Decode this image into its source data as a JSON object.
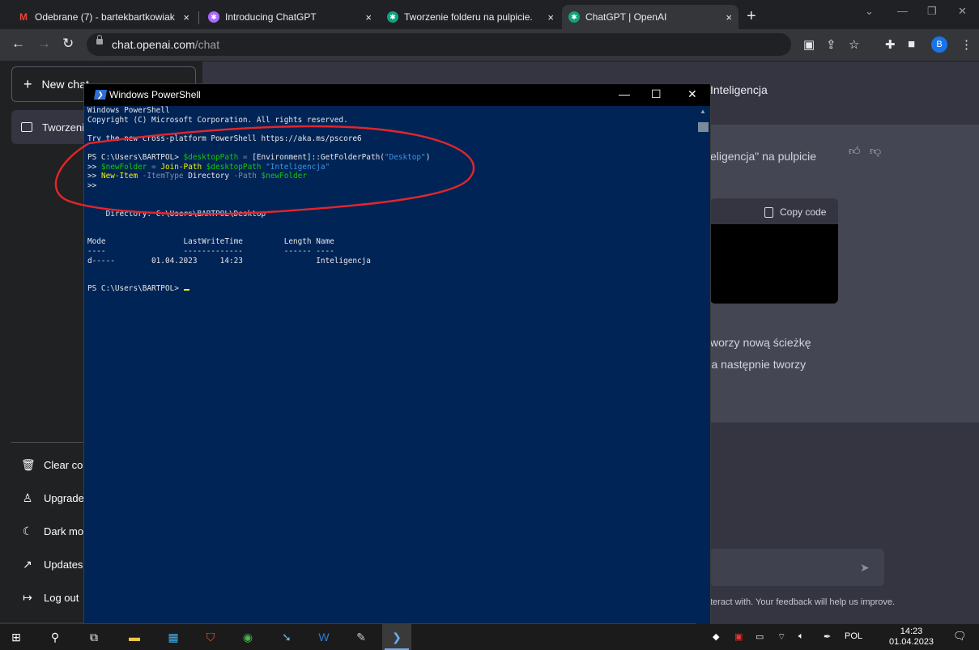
{
  "browser": {
    "tabs": [
      {
        "title": "Odebrane (7) - bartekbartkowiak",
        "favicon": "gmail-icon",
        "color": "#ea4335"
      },
      {
        "title": "Introducing ChatGPT",
        "favicon": "openai-icon",
        "color": "#ab68ff"
      },
      {
        "title": "Tworzenie folderu na pulpicie.",
        "favicon": "chatgpt-icon",
        "color": "#10a37f"
      },
      {
        "title": "ChatGPT | OpenAI",
        "favicon": "chatgpt-icon",
        "color": "#10a37f"
      }
    ],
    "close_glyph": "×",
    "new_tab_glyph": "+",
    "url_host": "chat.openai.com",
    "url_path": "/chat",
    "profile_initial": "B"
  },
  "sidebar": {
    "new_chat": "New chat",
    "chat_item": "Tworzenie",
    "bottom_items": [
      {
        "label": "Clear conv",
        "icon": "trash-icon",
        "glyph": "🗑"
      },
      {
        "label": "Upgrade t",
        "icon": "user-icon",
        "glyph": "♙"
      },
      {
        "label": "Dark mod",
        "icon": "moon-icon",
        "glyph": "☾"
      },
      {
        "label": "Updates &",
        "icon": "external-link-icon",
        "glyph": "↗"
      },
      {
        "label": "Log out",
        "icon": "logout-icon",
        "glyph": "↦"
      }
    ]
  },
  "chat": {
    "title": "Inteligencja",
    "response_line_1": "eligencja\" na pulpicie",
    "copy_code": "Copy code",
    "response_line_2": "worzy nową ścieżkę",
    "response_line_3": "', a następnie tworzy",
    "footer": "teract with. Your feedback will help us improve."
  },
  "powershell": {
    "window_title": "Windows PowerShell",
    "lines": [
      [
        {
          "t": "Windows PowerShell",
          "c": "w"
        }
      ],
      [
        {
          "t": "Copyright (C) Microsoft Corporation. All rights reserved.",
          "c": "w"
        }
      ],
      [
        {
          "t": "",
          "c": "w"
        }
      ],
      [
        {
          "t": "Try the new cross-platform PowerShell https://aka.ms/pscore6",
          "c": "w"
        }
      ],
      [
        {
          "t": "",
          "c": "w"
        }
      ],
      [
        {
          "t": "PS C:\\Users\\BARTPOL> ",
          "c": "w"
        },
        {
          "t": "$desktopPath",
          "c": "g"
        },
        {
          "t": " = ",
          "c": "gr"
        },
        {
          "t": "[Environment]",
          "c": "w"
        },
        {
          "t": "::GetFolderPath(",
          "c": "w"
        },
        {
          "t": "\"Desktop\"",
          "c": "cy"
        },
        {
          "t": ")",
          "c": "w"
        }
      ],
      [
        {
          "t": ">> ",
          "c": "w"
        },
        {
          "t": "$newFolder",
          "c": "g"
        },
        {
          "t": " = ",
          "c": "gr"
        },
        {
          "t": "Join-Path ",
          "c": "y"
        },
        {
          "t": "$desktopPath ",
          "c": "g"
        },
        {
          "t": "\"Inteligencja\"",
          "c": "cy"
        }
      ],
      [
        {
          "t": ">> ",
          "c": "w"
        },
        {
          "t": "New-Item ",
          "c": "y"
        },
        {
          "t": "-ItemType ",
          "c": "gr"
        },
        {
          "t": "Directory ",
          "c": "w"
        },
        {
          "t": "-Path ",
          "c": "gr"
        },
        {
          "t": "$newFolder",
          "c": "g"
        }
      ],
      [
        {
          "t": ">>",
          "c": "w"
        }
      ],
      [
        {
          "t": "",
          "c": "w"
        }
      ],
      [
        {
          "t": "",
          "c": "w"
        }
      ],
      [
        {
          "t": "    Directory: C:\\Users\\BARTPOL\\Desktop",
          "c": "w"
        }
      ],
      [
        {
          "t": "",
          "c": "w"
        }
      ],
      [
        {
          "t": "",
          "c": "w"
        }
      ],
      [
        {
          "t": "Mode                 LastWriteTime         Length Name",
          "c": "w"
        }
      ],
      [
        {
          "t": "----                 -------------         ------ ----",
          "c": "w"
        }
      ],
      [
        {
          "t": "d-----        01.04.2023     14:23                Inteligencja",
          "c": "w"
        }
      ],
      [
        {
          "t": "",
          "c": "w"
        }
      ],
      [
        {
          "t": "",
          "c": "w"
        }
      ],
      [
        {
          "t": "PS C:\\Users\\BARTPOL> ",
          "c": "w"
        }
      ]
    ],
    "annotation_color": "#e3262b"
  },
  "taskbar": {
    "tray_language": "POL",
    "time": "14:23",
    "date": "01.04.2023"
  }
}
